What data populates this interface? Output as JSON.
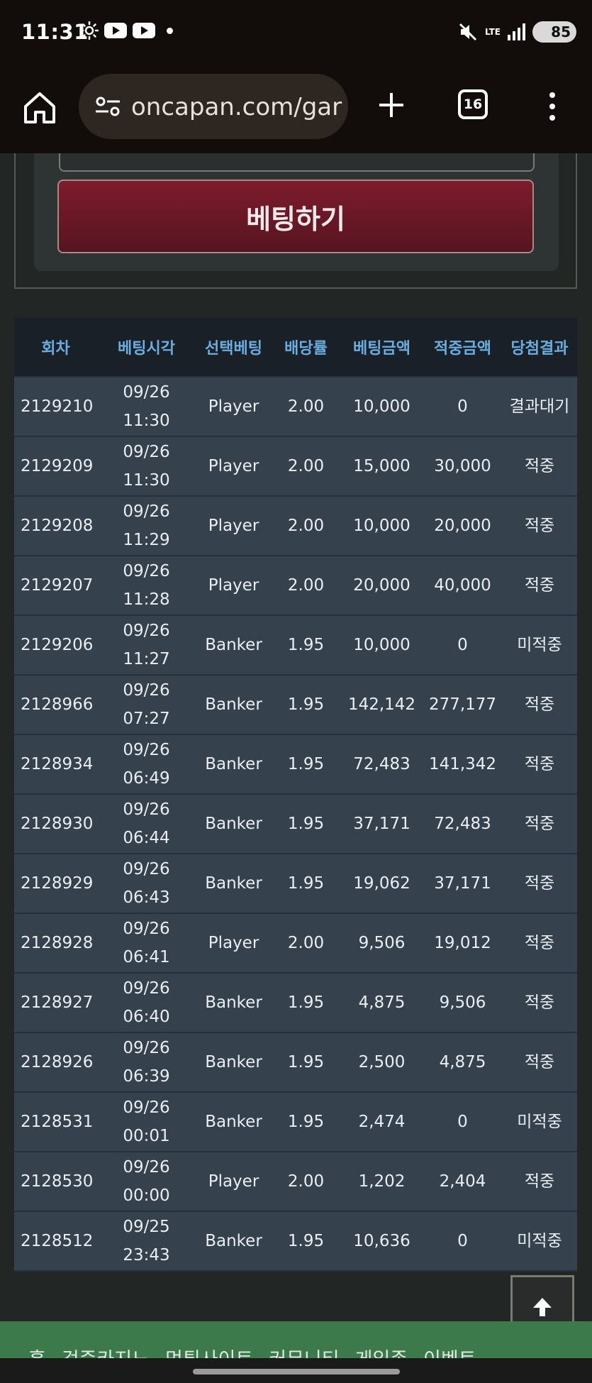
{
  "status_bar": {
    "time": "11:31",
    "network": "LTE",
    "battery": "85"
  },
  "browser": {
    "url": "oncapan.com/gar",
    "tab_count": "16"
  },
  "bet_panel": {
    "button_label": "베팅하기"
  },
  "table": {
    "headers": [
      "회차",
      "베팅시각",
      "선택베팅",
      "배당률",
      "베팅금액",
      "적중금액",
      "당첨결과"
    ],
    "rows": [
      {
        "round": "2129210",
        "date": "09/26",
        "time": "11:30",
        "pick": "Player",
        "odds": "2.00",
        "bet": "10,000",
        "win": "0",
        "result": "결과대기",
        "status": "pending"
      },
      {
        "round": "2129209",
        "date": "09/26",
        "time": "11:30",
        "pick": "Player",
        "odds": "2.00",
        "bet": "15,000",
        "win": "30,000",
        "result": "적중",
        "status": "hit"
      },
      {
        "round": "2129208",
        "date": "09/26",
        "time": "11:29",
        "pick": "Player",
        "odds": "2.00",
        "bet": "10,000",
        "win": "20,000",
        "result": "적중",
        "status": "hit"
      },
      {
        "round": "2129207",
        "date": "09/26",
        "time": "11:28",
        "pick": "Player",
        "odds": "2.00",
        "bet": "20,000",
        "win": "40,000",
        "result": "적중",
        "status": "hit"
      },
      {
        "round": "2129206",
        "date": "09/26",
        "time": "11:27",
        "pick": "Banker",
        "odds": "1.95",
        "bet": "10,000",
        "win": "0",
        "result": "미적중",
        "status": "miss"
      },
      {
        "round": "2128966",
        "date": "09/26",
        "time": "07:27",
        "pick": "Banker",
        "odds": "1.95",
        "bet": "142,142",
        "win": "277,177",
        "result": "적중",
        "status": "hit"
      },
      {
        "round": "2128934",
        "date": "09/26",
        "time": "06:49",
        "pick": "Banker",
        "odds": "1.95",
        "bet": "72,483",
        "win": "141,342",
        "result": "적중",
        "status": "hit"
      },
      {
        "round": "2128930",
        "date": "09/26",
        "time": "06:44",
        "pick": "Banker",
        "odds": "1.95",
        "bet": "37,171",
        "win": "72,483",
        "result": "적중",
        "status": "hit"
      },
      {
        "round": "2128929",
        "date": "09/26",
        "time": "06:43",
        "pick": "Banker",
        "odds": "1.95",
        "bet": "19,062",
        "win": "37,171",
        "result": "적중",
        "status": "hit"
      },
      {
        "round": "2128928",
        "date": "09/26",
        "time": "06:41",
        "pick": "Player",
        "odds": "2.00",
        "bet": "9,506",
        "win": "19,012",
        "result": "적중",
        "status": "hit"
      },
      {
        "round": "2128927",
        "date": "09/26",
        "time": "06:40",
        "pick": "Banker",
        "odds": "1.95",
        "bet": "4,875",
        "win": "9,506",
        "result": "적중",
        "status": "hit"
      },
      {
        "round": "2128926",
        "date": "09/26",
        "time": "06:39",
        "pick": "Banker",
        "odds": "1.95",
        "bet": "2,500",
        "win": "4,875",
        "result": "적중",
        "status": "hit"
      },
      {
        "round": "2128531",
        "date": "09/26",
        "time": "00:01",
        "pick": "Banker",
        "odds": "1.95",
        "bet": "2,474",
        "win": "0",
        "result": "미적중",
        "status": "miss"
      },
      {
        "round": "2128530",
        "date": "09/26",
        "time": "00:00",
        "pick": "Player",
        "odds": "2.00",
        "bet": "1,202",
        "win": "2,404",
        "result": "적중",
        "status": "hit"
      },
      {
        "round": "2128512",
        "date": "09/25",
        "time": "23:43",
        "pick": "Banker",
        "odds": "1.95",
        "bet": "10,636",
        "win": "0",
        "result": "미적중",
        "status": "miss"
      }
    ]
  },
  "bottom_nav": {
    "items": [
      "홈",
      "검증카지노",
      "먹튀사이트",
      "커뮤니티",
      "게임존",
      "이벤트"
    ]
  },
  "colors": {
    "header_text": "#6aaee0",
    "hit": "#e6a941",
    "miss": "#e0444f",
    "button": "#7d1c2c",
    "nav": "#3c7a4b"
  }
}
